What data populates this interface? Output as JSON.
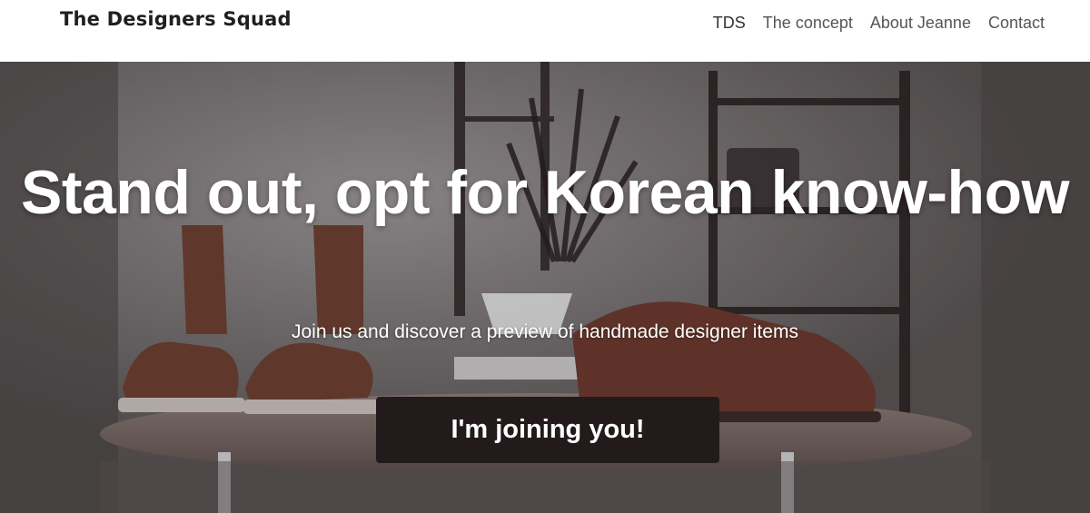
{
  "navbar": {
    "brand": "The Designers Squad",
    "links": [
      "TDS",
      "The concept",
      "About Jeanne",
      "Contact"
    ]
  },
  "hero": {
    "title": "Stand out, opt for Korean know-how",
    "subtitle": "Join us and discover a preview of handmade designer items",
    "cta_label": "I'm joining you!"
  },
  "colors": {
    "cta_background": "#231b1b",
    "hero_text": "#ffffff",
    "brand_text": "#1f1f1f"
  }
}
